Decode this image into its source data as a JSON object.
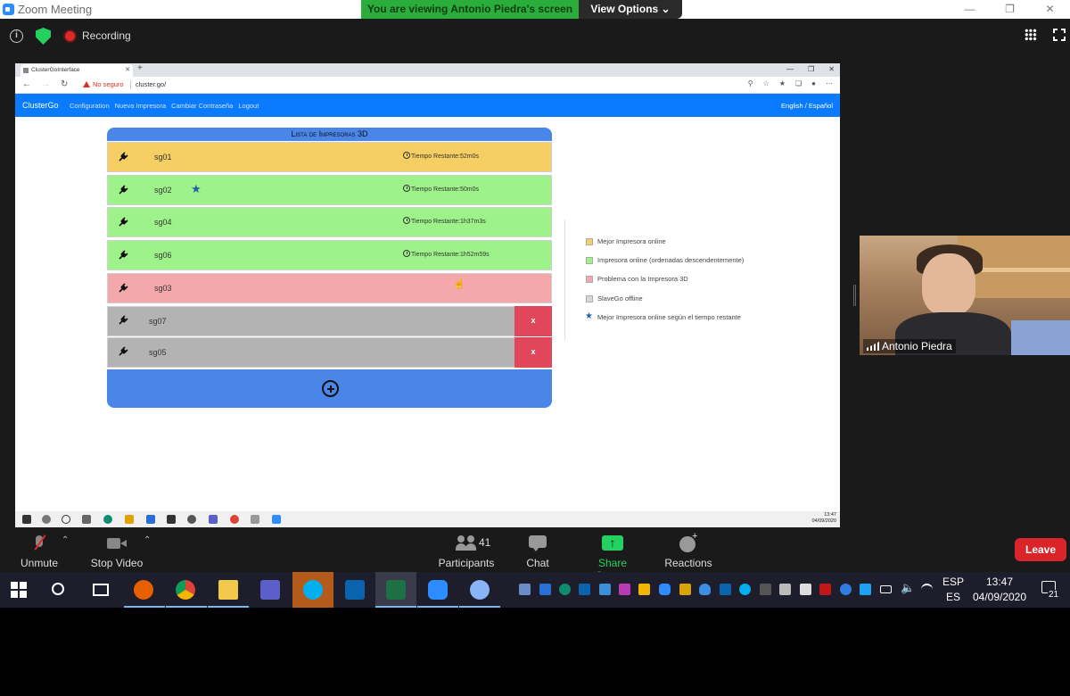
{
  "zoom_window": {
    "title": "Zoom Meeting",
    "viewing_banner": "You are viewing Antonio Piedra's screen",
    "view_options": "View Options ⌄",
    "recording_label": "Recording"
  },
  "browser": {
    "tab_title": "ClusterGoInterface",
    "not_secure": "No seguro",
    "url": "cluster.go/"
  },
  "app": {
    "brand": "ClusterGo",
    "nav_links": [
      "Configuration",
      "Nueva Impresora",
      "Cambiar Contraseña",
      "Logout"
    ],
    "language": "English / Español",
    "list_title": "Lista de Impresoras 3D",
    "printers": [
      {
        "name": "sg01",
        "status": "best",
        "color": "#f5cf63",
        "time": "Tiempo Restante:52m0s",
        "star": false,
        "removable": false
      },
      {
        "name": "sg02",
        "status": "online",
        "color": "#9ef28a",
        "time": "Tiempo Restante:50m0s",
        "star": true,
        "removable": false
      },
      {
        "name": "sg04",
        "status": "online",
        "color": "#9ef28a",
        "time": "Tiempo Restante:1h37m3s",
        "star": false,
        "removable": false
      },
      {
        "name": "sg06",
        "status": "online",
        "color": "#9ef28a",
        "time": "Tiempo Restante:1h52m59s",
        "star": false,
        "removable": false
      },
      {
        "name": "sg03",
        "status": "problem",
        "color": "#f4a8ab",
        "time": "",
        "star": false,
        "removable": false
      },
      {
        "name": "sg07",
        "status": "offline",
        "color": "#b3b3b3",
        "time": "",
        "star": false,
        "removable": true
      },
      {
        "name": "sg05",
        "status": "offline",
        "color": "#b3b3b3",
        "time": "",
        "star": false,
        "removable": true
      }
    ],
    "remove_label": "x",
    "legend": [
      {
        "label": "Mejor Impresora online",
        "color": "#f5cf63"
      },
      {
        "label": "Impresora online (ordenadas descendentemente)",
        "color": "#9ef28a"
      },
      {
        "label": "Problema con la Impresora 3D",
        "color": "#f4a8ab"
      },
      {
        "label": "SlaveGo offline",
        "color": "#d8d8d8"
      },
      {
        "label": "Mejor Impresora online según el tiempo restante",
        "color": "#1f5fa8"
      }
    ]
  },
  "inner_taskbar": {
    "time": "13:47",
    "date": "04/09/2020"
  },
  "participant": {
    "name": "Antonio Piedra"
  },
  "zoom_toolbar": {
    "unmute": "Unmute",
    "stop_video": "Stop Video",
    "participants": "Participants",
    "participants_count": "41",
    "chat": "Chat",
    "share_screen": "Share Screen",
    "reactions": "Reactions",
    "leave": "Leave"
  },
  "windows_taskbar": {
    "lang_top": "ESP",
    "lang_bottom": "ES",
    "time": "13:47",
    "date": "04/09/2020",
    "notifications": "21"
  }
}
